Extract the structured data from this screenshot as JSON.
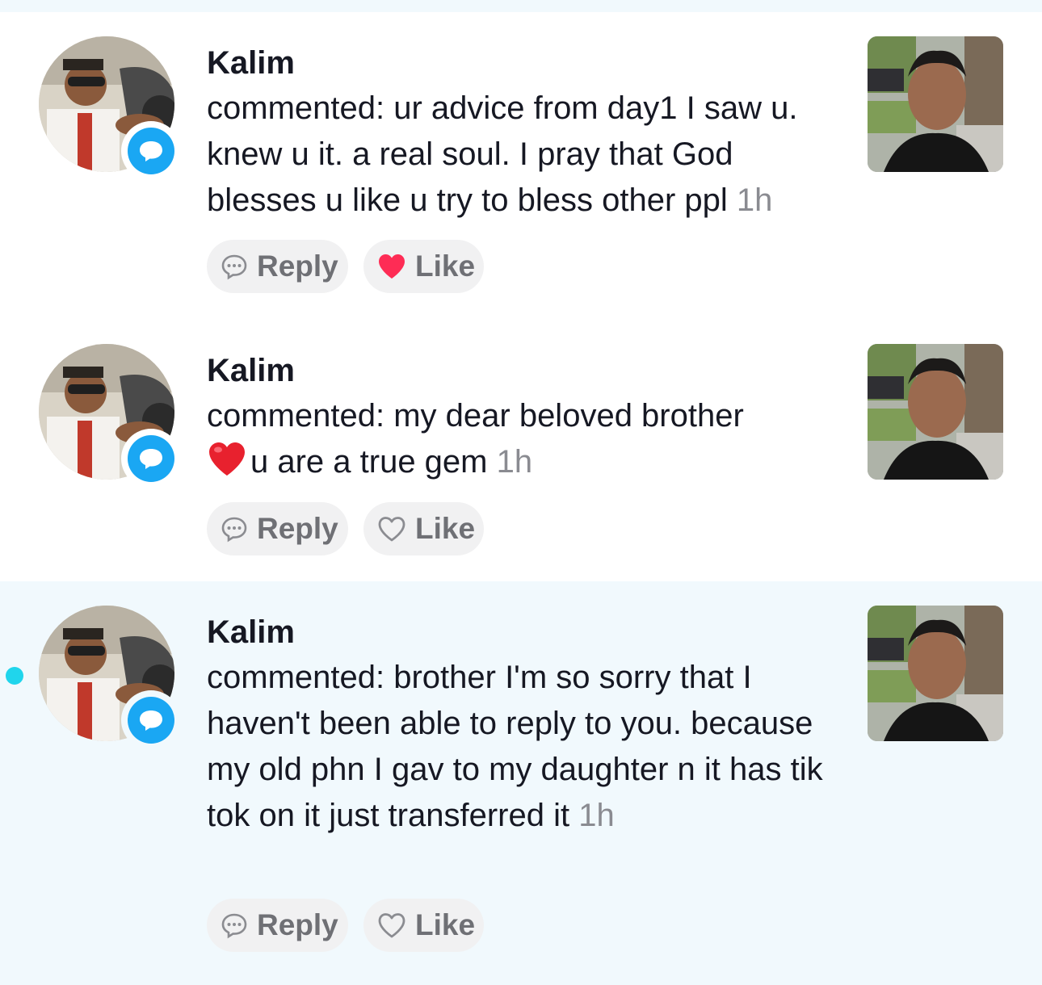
{
  "notifications": [
    {
      "username": "Kalim",
      "comment_prefix": "commented: ur advice from day1 I saw u. knew u it. a real soul. I pray that God blesses u like u try to bless other ppl",
      "comment_emoji": "",
      "comment_rest": "",
      "time": "1h",
      "reply_label": "Reply",
      "like_label": "Like",
      "liked": true,
      "unread": false,
      "badge_icon": "comment-bubble-icon"
    },
    {
      "username": "Kalim",
      "comment_prefix": "commented: my dear beloved brother ",
      "comment_emoji": "❤️",
      "comment_rest": "u are a true gem",
      "time": "1h",
      "reply_label": "Reply",
      "like_label": "Like",
      "liked": false,
      "unread": false,
      "badge_icon": "comment-bubble-icon"
    },
    {
      "username": "Kalim",
      "comment_prefix": "commented: brother I'm so sorry that I haven't been able to reply to you. because my old phn I gav to my daughter n it has tik tok on it just transferred it",
      "comment_emoji": "",
      "comment_rest": "",
      "time": "1h",
      "reply_label": "Reply",
      "like_label": "Like",
      "liked": false,
      "unread": true,
      "badge_icon": "comment-bubble-icon"
    }
  ],
  "colors": {
    "liked_heart": "#fe2c55",
    "badge_blue": "#1aa7f3",
    "unread_dot": "#20d5ec",
    "unread_background": "#f1f9fd",
    "timestamp": "#8a8b91"
  },
  "icons": {
    "reply": "speech-bubble-icon",
    "like": "heart-icon"
  }
}
